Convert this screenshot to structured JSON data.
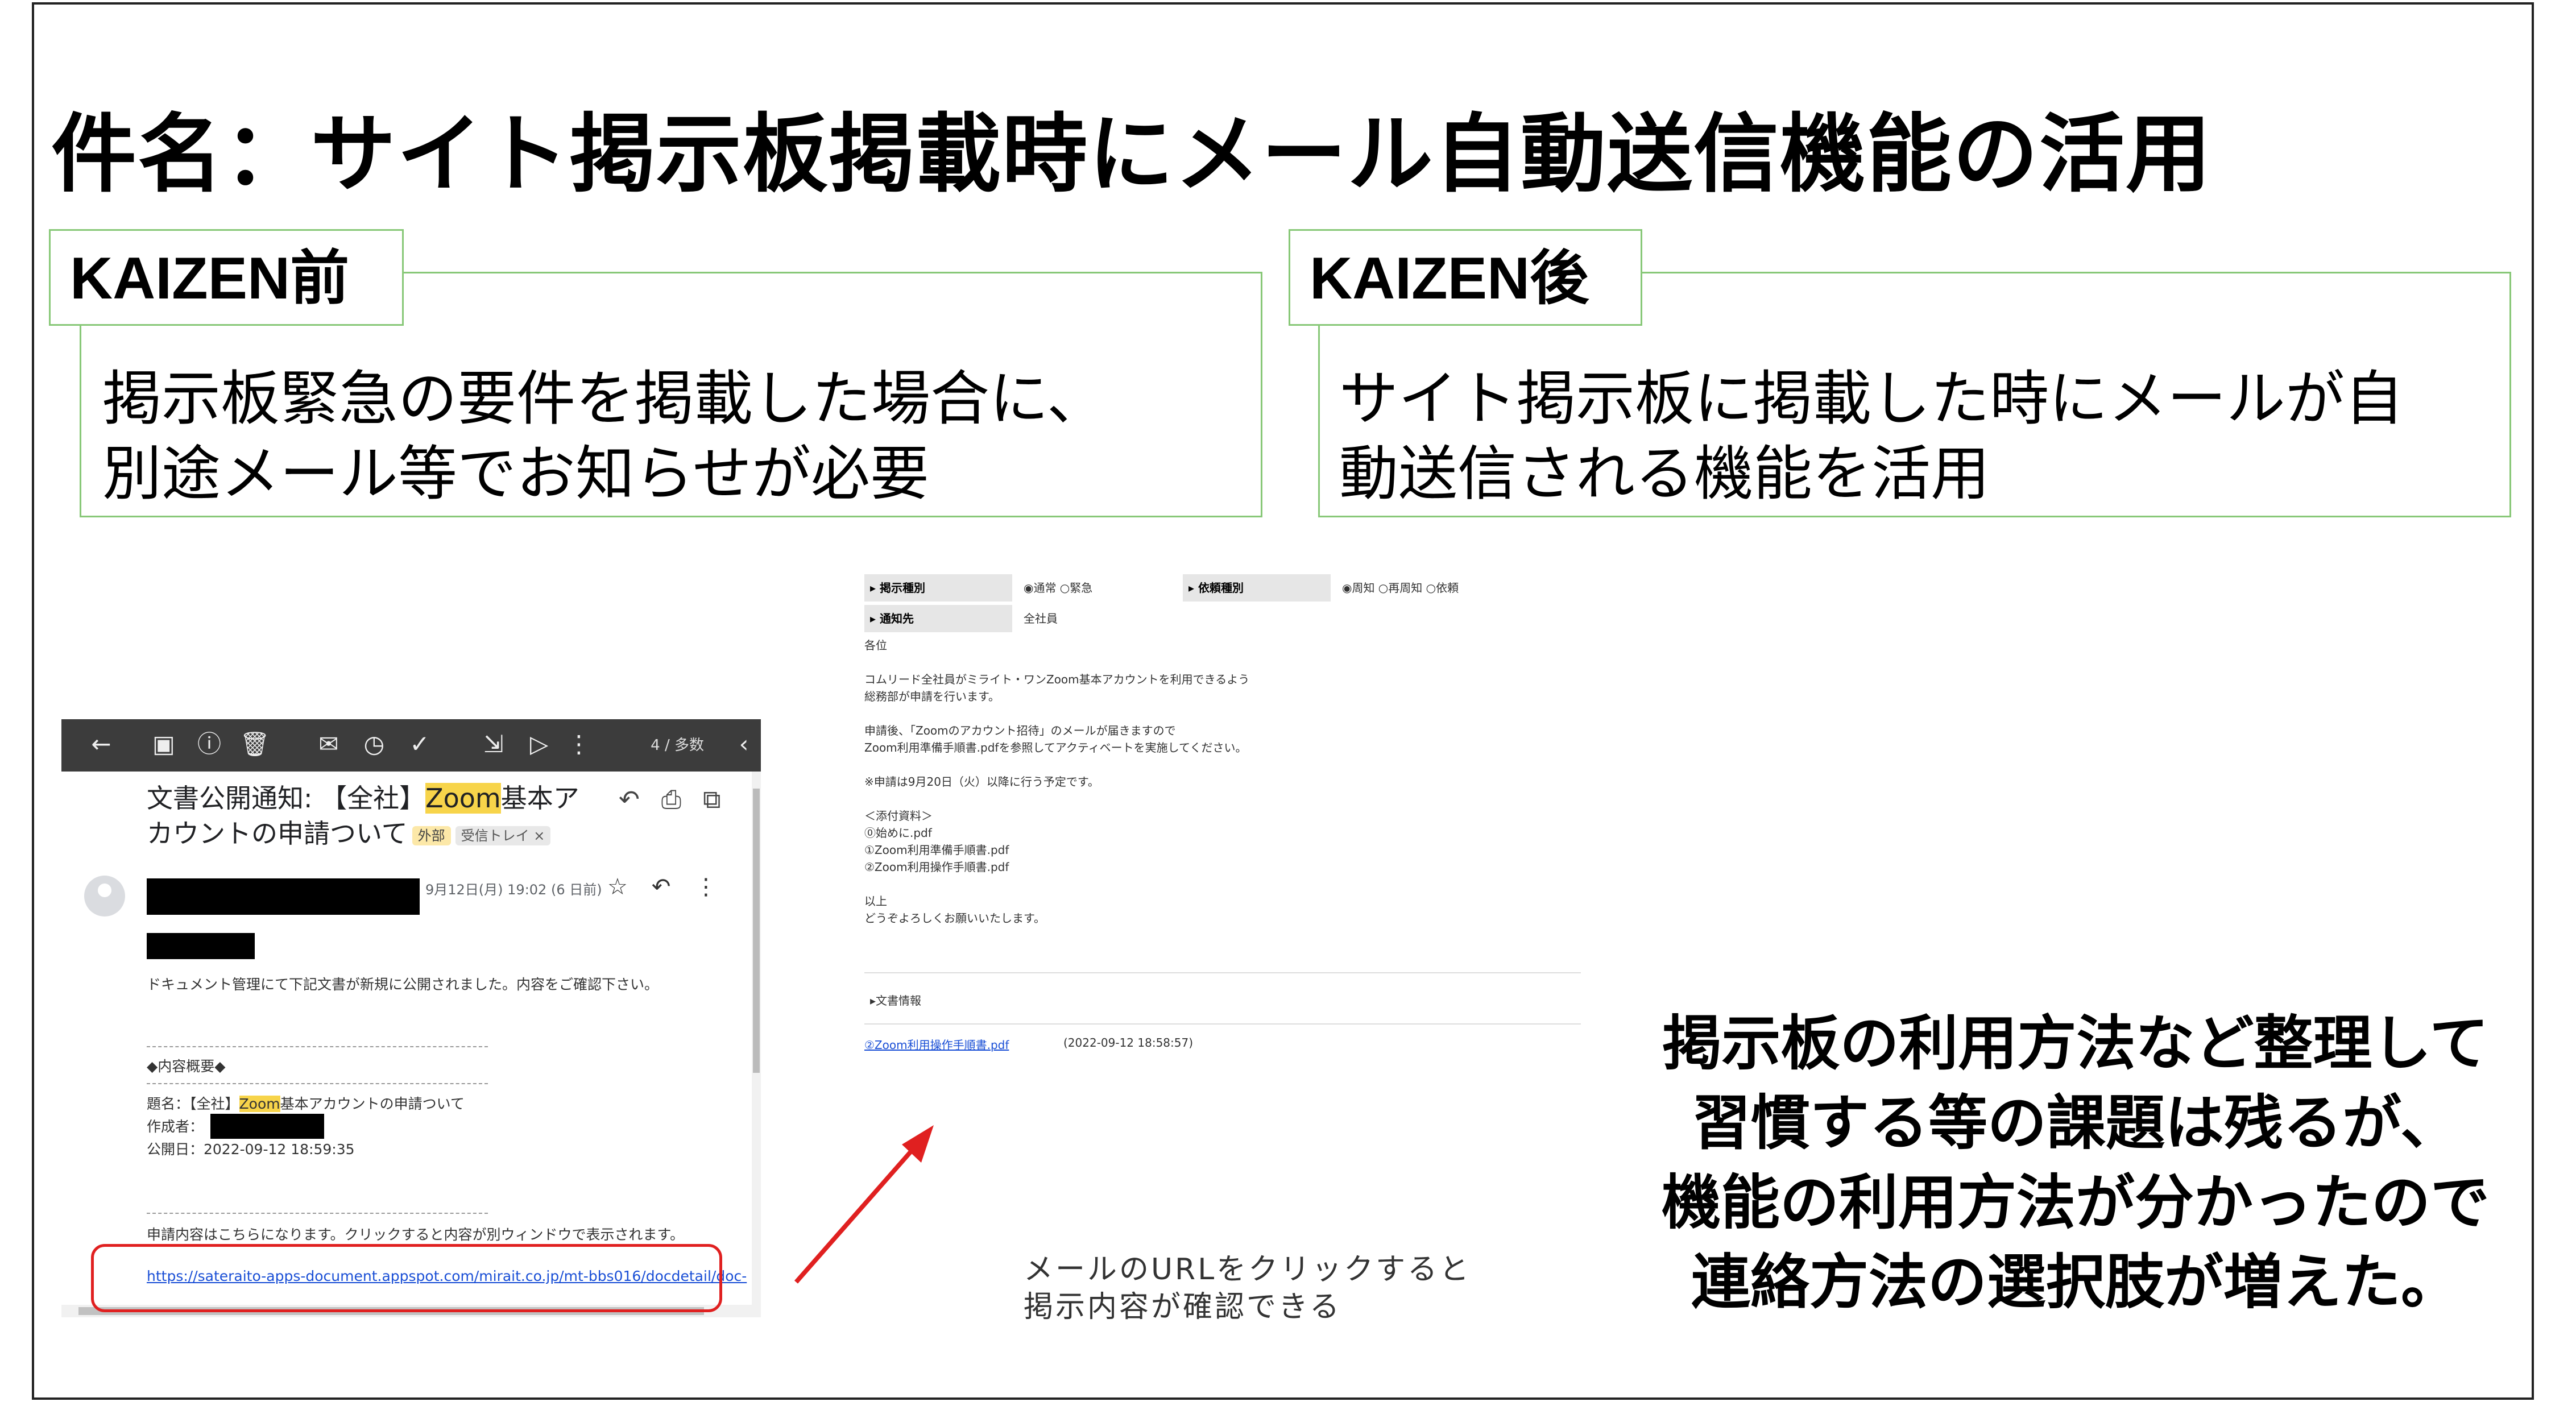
{
  "title": "件名：サイト掲示板掲載時にメール自動送信機能の活用",
  "before": {
    "label": "KAIZEN前",
    "lines": [
      "掲示板緊急の要件を掲載した場合に、",
      "別途メール等でお知らせが必要"
    ]
  },
  "after": {
    "label": "KAIZEN後",
    "lines": [
      "サイト掲示板に掲載した時にメールが自",
      "動送信される機能を活用"
    ]
  },
  "gmail": {
    "counter": "4 / 多数",
    "subject_prefix": "文書公開通知: 【全社】",
    "subject_highlight": "Zoom",
    "subject_rest": "基本アカウントの申請ついて",
    "chip_external": "外部",
    "chip_inbox": "受信トレイ ×",
    "date": "9月12日(月) 19:02 (6 日前)",
    "notice": "ドキュメント管理にて下記文書が新規に公開されました。内容をご確認下さい。",
    "summary_header": "◆内容概要◆",
    "title_label": "題名：【全社】",
    "title_highlight": "Zoom",
    "title_rest": "基本アカウントの申請ついて",
    "author_label": "作成者：",
    "published": "公開日：2022-09-12 18:59:35",
    "footer_note": "申請内容はこちらになります。クリックすると内容が別ウィンドウで表示されます。",
    "link": "https://sateraito-apps-document.appspot.com/mirait.co.jp/mt-bbs016/docdetail/doc-"
  },
  "board": {
    "field1_label": "▸ 掲示種別",
    "field1_value": "◉通常 ○緊急",
    "field2_label": "▸ 依頼種別",
    "field2_value": "◉周知 ○再周知 ○依頼",
    "field3_label": "▸ 通知先",
    "field3_value": "全社員",
    "body": [
      "各位",
      "",
      "コムリード全社員がミライト・ワンZoom基本アカウントを利用できるよう",
      "総務部が申請を行います。",
      "",
      "申請後、「Zoomのアカウント招待」のメールが届きますので",
      "Zoom利用準備手順書.pdfを参照してアクティベートを実施してください。",
      "",
      "※申請は9月20日（火）以降に行う予定です。",
      "",
      "＜添付資料＞",
      "⓪始めに.pdf",
      "①Zoom利用準備手順書.pdf",
      "②Zoom利用操作手順書.pdf",
      "",
      "以上",
      "どうぞよろしくお願いいたします。"
    ],
    "doc_info": "▸文書情報",
    "attachment": "②Zoom利用操作手順書.pdf",
    "attachment_time": "(2022-09-12 18:58:57)"
  },
  "caption_lines": [
    "メールのURLをクリックすると",
    "掲示内容が確認できる"
  ],
  "conclusion_lines": [
    "掲示板の利用方法など整理して",
    "習慣する等の課題は残るが、",
    "機能の利用方法が分かったので",
    "連絡方法の選択肢が増えた。"
  ],
  "colors": {
    "box_border": "#88c878",
    "highlight": "#f7d44a",
    "oval": "#e02020"
  }
}
